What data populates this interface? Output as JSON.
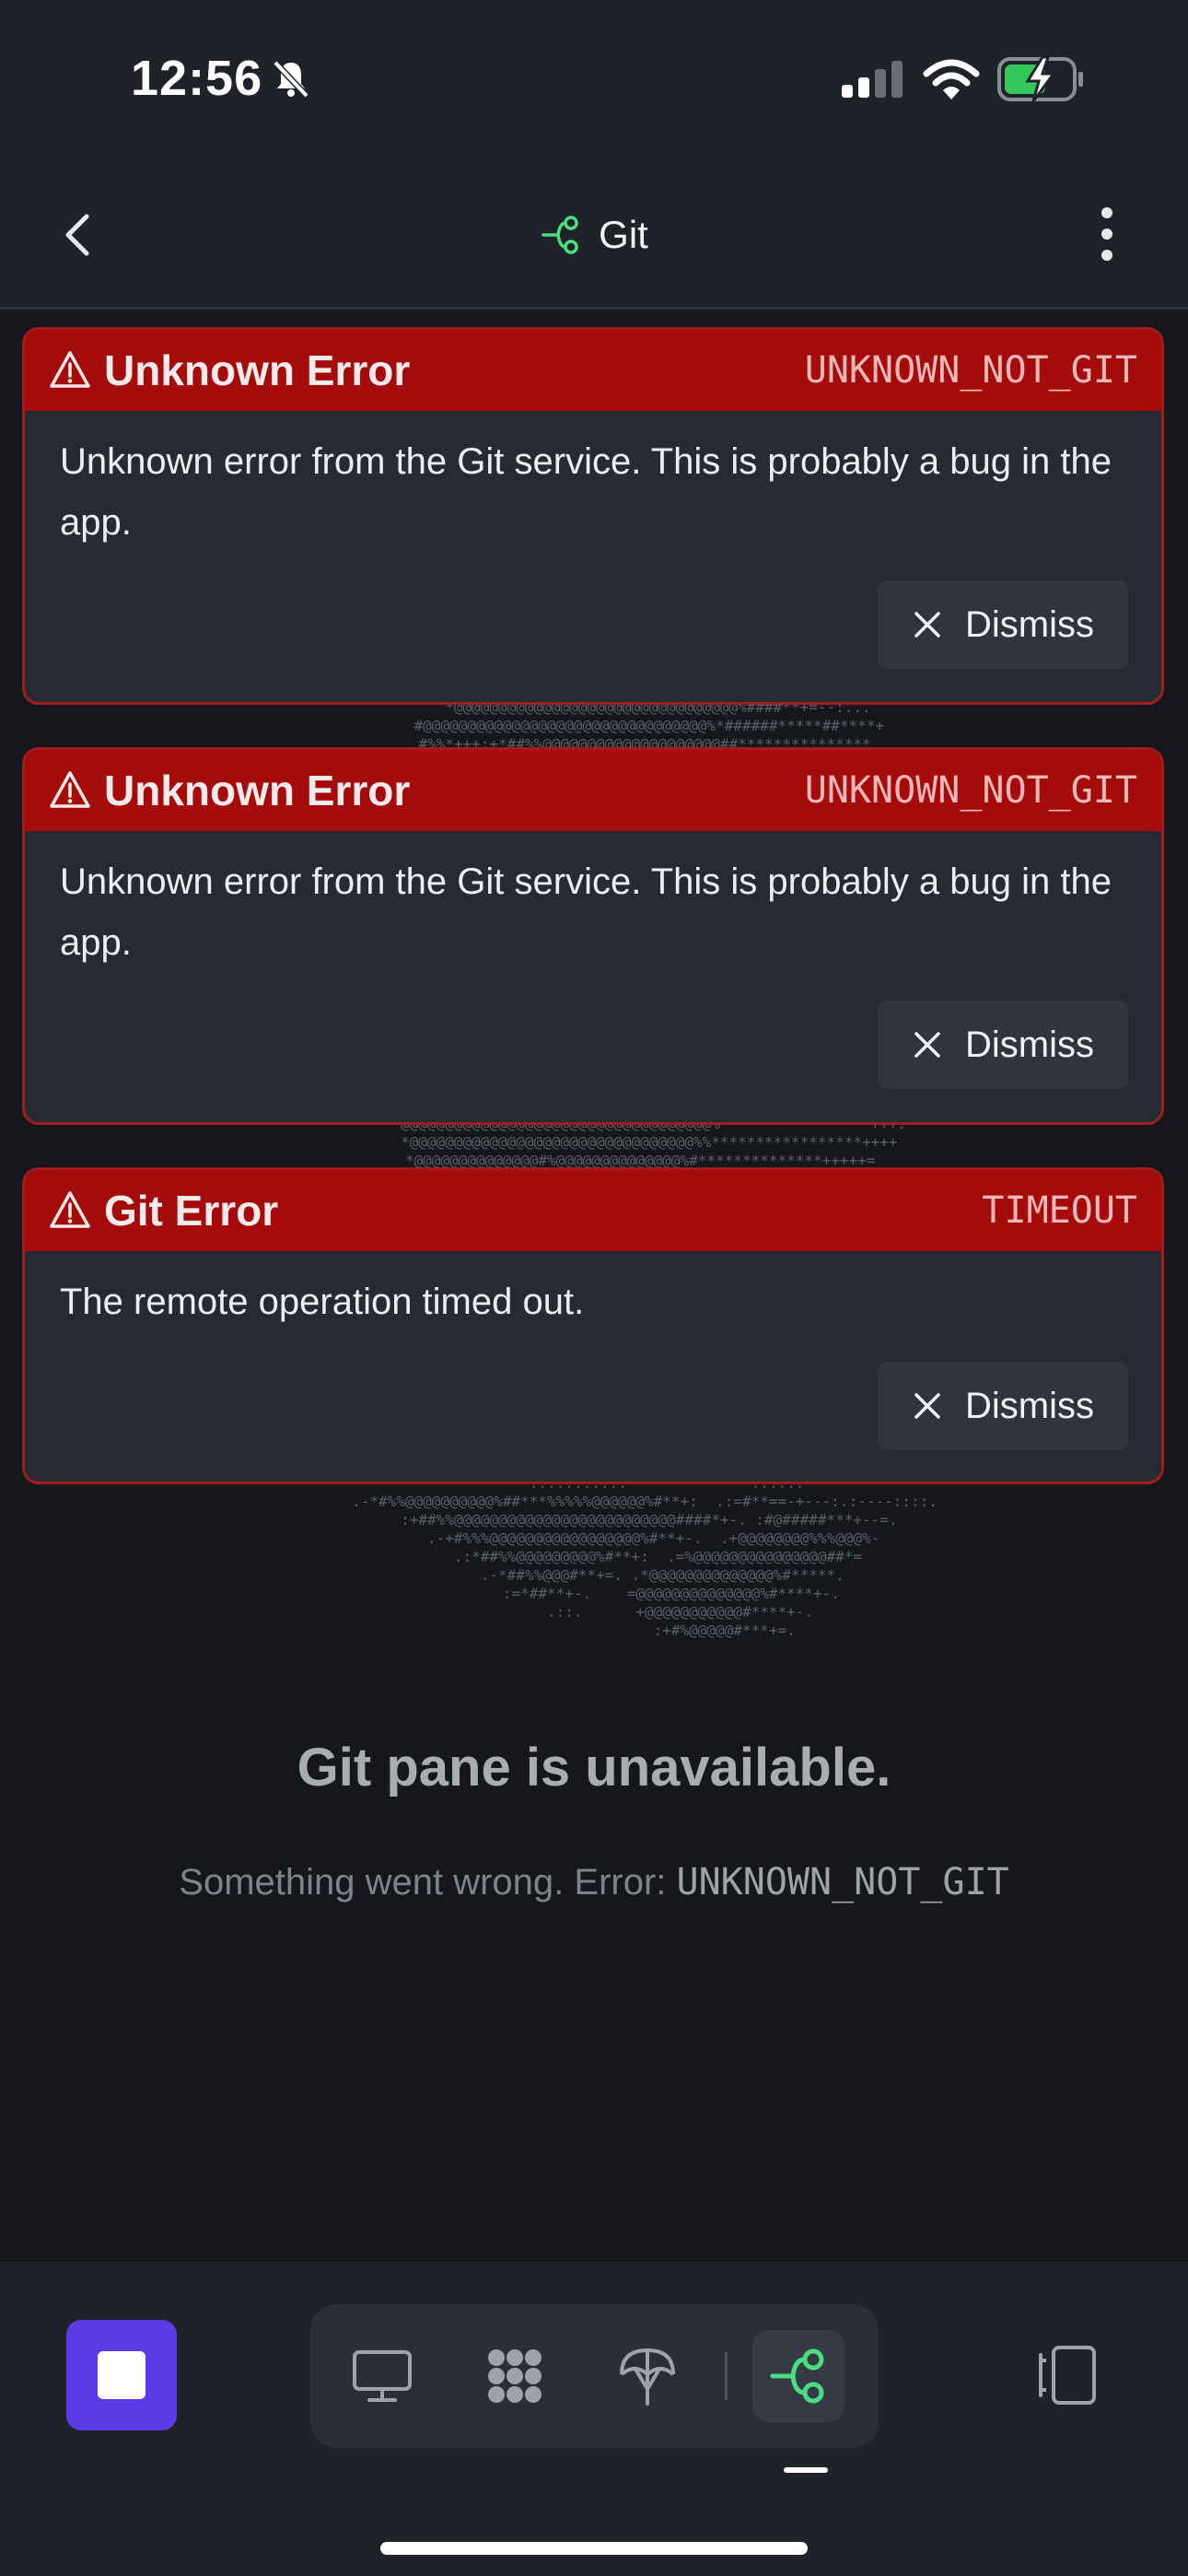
{
  "status_bar": {
    "time": "12:56"
  },
  "header": {
    "title": "Git"
  },
  "errors": [
    {
      "title": "Unknown Error",
      "code": "UNKNOWN_NOT_GIT",
      "message": "Unknown error from the Git service. This is probably a bug in the app.",
      "dismiss_label": "Dismiss"
    },
    {
      "title": "Unknown Error",
      "code": "UNKNOWN_NOT_GIT",
      "message": "Unknown error from the Git service. This is probably a bug in the app.",
      "dismiss_label": "Dismiss"
    },
    {
      "title": "Git Error",
      "code": "TIMEOUT",
      "message": "The remote operation timed out.",
      "dismiss_label": "Dismiss"
    }
  ],
  "empty_state": {
    "title": "Git pane is unavailable.",
    "subtitle_prefix": "Something went wrong. Error: ",
    "error_code": "UNKNOWN_NOT_GIT"
  },
  "colors": {
    "accent": "#5b3be6",
    "error_header": "#a50b0b",
    "git_green": "#4ade80"
  },
  "bottom_nav": {
    "tabs": [
      {
        "icon": "monitor-icon",
        "active": false
      },
      {
        "icon": "grid-dots-icon",
        "active": false
      },
      {
        "icon": "antenna-icon",
        "active": false
      },
      {
        "icon": "git-branch-icon",
        "active": true
      }
    ]
  }
}
